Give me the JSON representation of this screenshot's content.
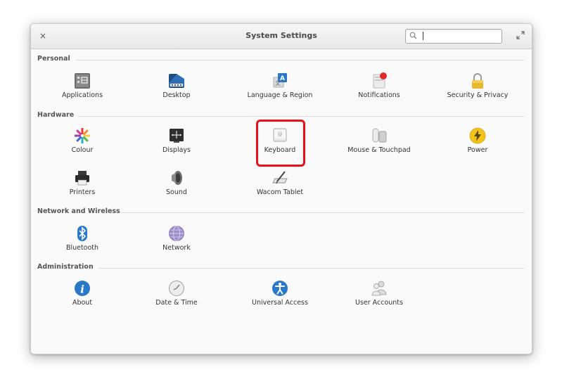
{
  "window": {
    "title": "System Settings",
    "close_glyph": "×",
    "search": {
      "placeholder": "",
      "value": ""
    }
  },
  "sections": {
    "personal": {
      "title": "Personal",
      "items": [
        {
          "label": "Applications",
          "icon": "applications-icon"
        },
        {
          "label": "Desktop",
          "icon": "desktop-icon"
        },
        {
          "label": "Language & Region",
          "icon": "language-region-icon"
        },
        {
          "label": "Notifications",
          "icon": "notifications-icon"
        },
        {
          "label": "Security & Privacy",
          "icon": "security-privacy-icon"
        }
      ]
    },
    "hardware": {
      "title": "Hardware",
      "items": [
        {
          "label": "Colour",
          "icon": "colour-icon"
        },
        {
          "label": "Displays",
          "icon": "displays-icon"
        },
        {
          "label": "Keyboard",
          "icon": "keyboard-icon"
        },
        {
          "label": "Mouse & Touchpad",
          "icon": "mouse-touchpad-icon"
        },
        {
          "label": "Power",
          "icon": "power-icon"
        },
        {
          "label": "Printers",
          "icon": "printers-icon"
        },
        {
          "label": "Sound",
          "icon": "sound-icon"
        },
        {
          "label": "Wacom Tablet",
          "icon": "wacom-tablet-icon"
        }
      ]
    },
    "network": {
      "title": "Network and Wireless",
      "items": [
        {
          "label": "Bluetooth",
          "icon": "bluetooth-icon"
        },
        {
          "label": "Network",
          "icon": "network-icon"
        }
      ]
    },
    "administration": {
      "title": "Administration",
      "items": [
        {
          "label": "About",
          "icon": "about-icon"
        },
        {
          "label": "Date & Time",
          "icon": "date-time-icon"
        },
        {
          "label": "Universal Access",
          "icon": "universal-access-icon"
        },
        {
          "label": "User Accounts",
          "icon": "user-accounts-icon"
        }
      ]
    }
  },
  "highlighted_item": "Keyboard",
  "colors": {
    "highlight": "#e8101a",
    "accent_blue": "#2a78c8",
    "power_yellow": "#f4c21c"
  }
}
